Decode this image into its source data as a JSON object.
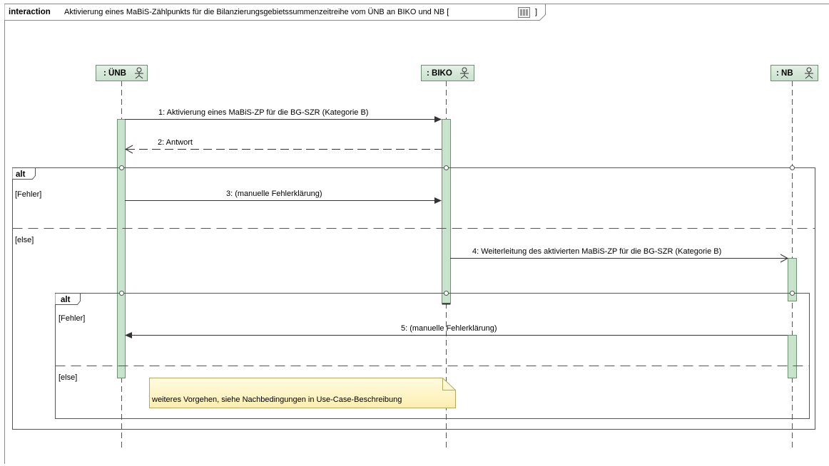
{
  "frame": {
    "keyword": "interaction",
    "title": "Aktivierung eines MaBiS-Zählpunkts für die Bilanzierungsgebietssummenzeitreihe vom ÜNB an BIKO und NB [",
    "title_end": "]",
    "icon": "diagram-icon"
  },
  "lifelines": [
    {
      "id": "uenb",
      "label": ": ÜNB",
      "icon": "actor-icon"
    },
    {
      "id": "biko",
      "label": ": BIKO",
      "icon": "actor-icon"
    },
    {
      "id": "nb",
      "label": ": NB",
      "icon": "actor-icon"
    }
  ],
  "messages": [
    {
      "id": "m1",
      "label": "1: Aktivierung eines MaBiS-ZP für die BG-SZR (Kategorie B)",
      "from": "uenb",
      "to": "biko",
      "kind": "sync"
    },
    {
      "id": "m2",
      "label": "2: Antwort",
      "from": "biko",
      "to": "uenb",
      "kind": "reply"
    },
    {
      "id": "m3",
      "label": "3: (manuelle Fehlerklärung)",
      "from": "uenb",
      "to": "biko",
      "kind": "sync"
    },
    {
      "id": "m4",
      "label": "4: Weiterleitung des aktivierten MaBiS-ZP für die BG-SZR (Kategorie B)",
      "from": "biko",
      "to": "nb",
      "kind": "async"
    },
    {
      "id": "m5",
      "label": "5: (manuelle Fehlerklärung)",
      "from": "nb",
      "to": "uenb",
      "kind": "sync"
    }
  ],
  "fragments": [
    {
      "id": "alt-outer",
      "operator": "alt",
      "guards": [
        "[Fehler]",
        "[else]"
      ]
    },
    {
      "id": "alt-inner",
      "operator": "alt",
      "guards": [
        "[Fehler]",
        "[else]"
      ]
    }
  ],
  "note": {
    "text": "weiteres Vorgehen, siehe Nachbedingungen in Use-Case-Beschreibung"
  },
  "colors": {
    "lifeline_head_fill": "#d4e8d7",
    "activation_fill": "#c7e3cc",
    "note_fill": "#fff6c9",
    "line": "#5a5a5a"
  }
}
